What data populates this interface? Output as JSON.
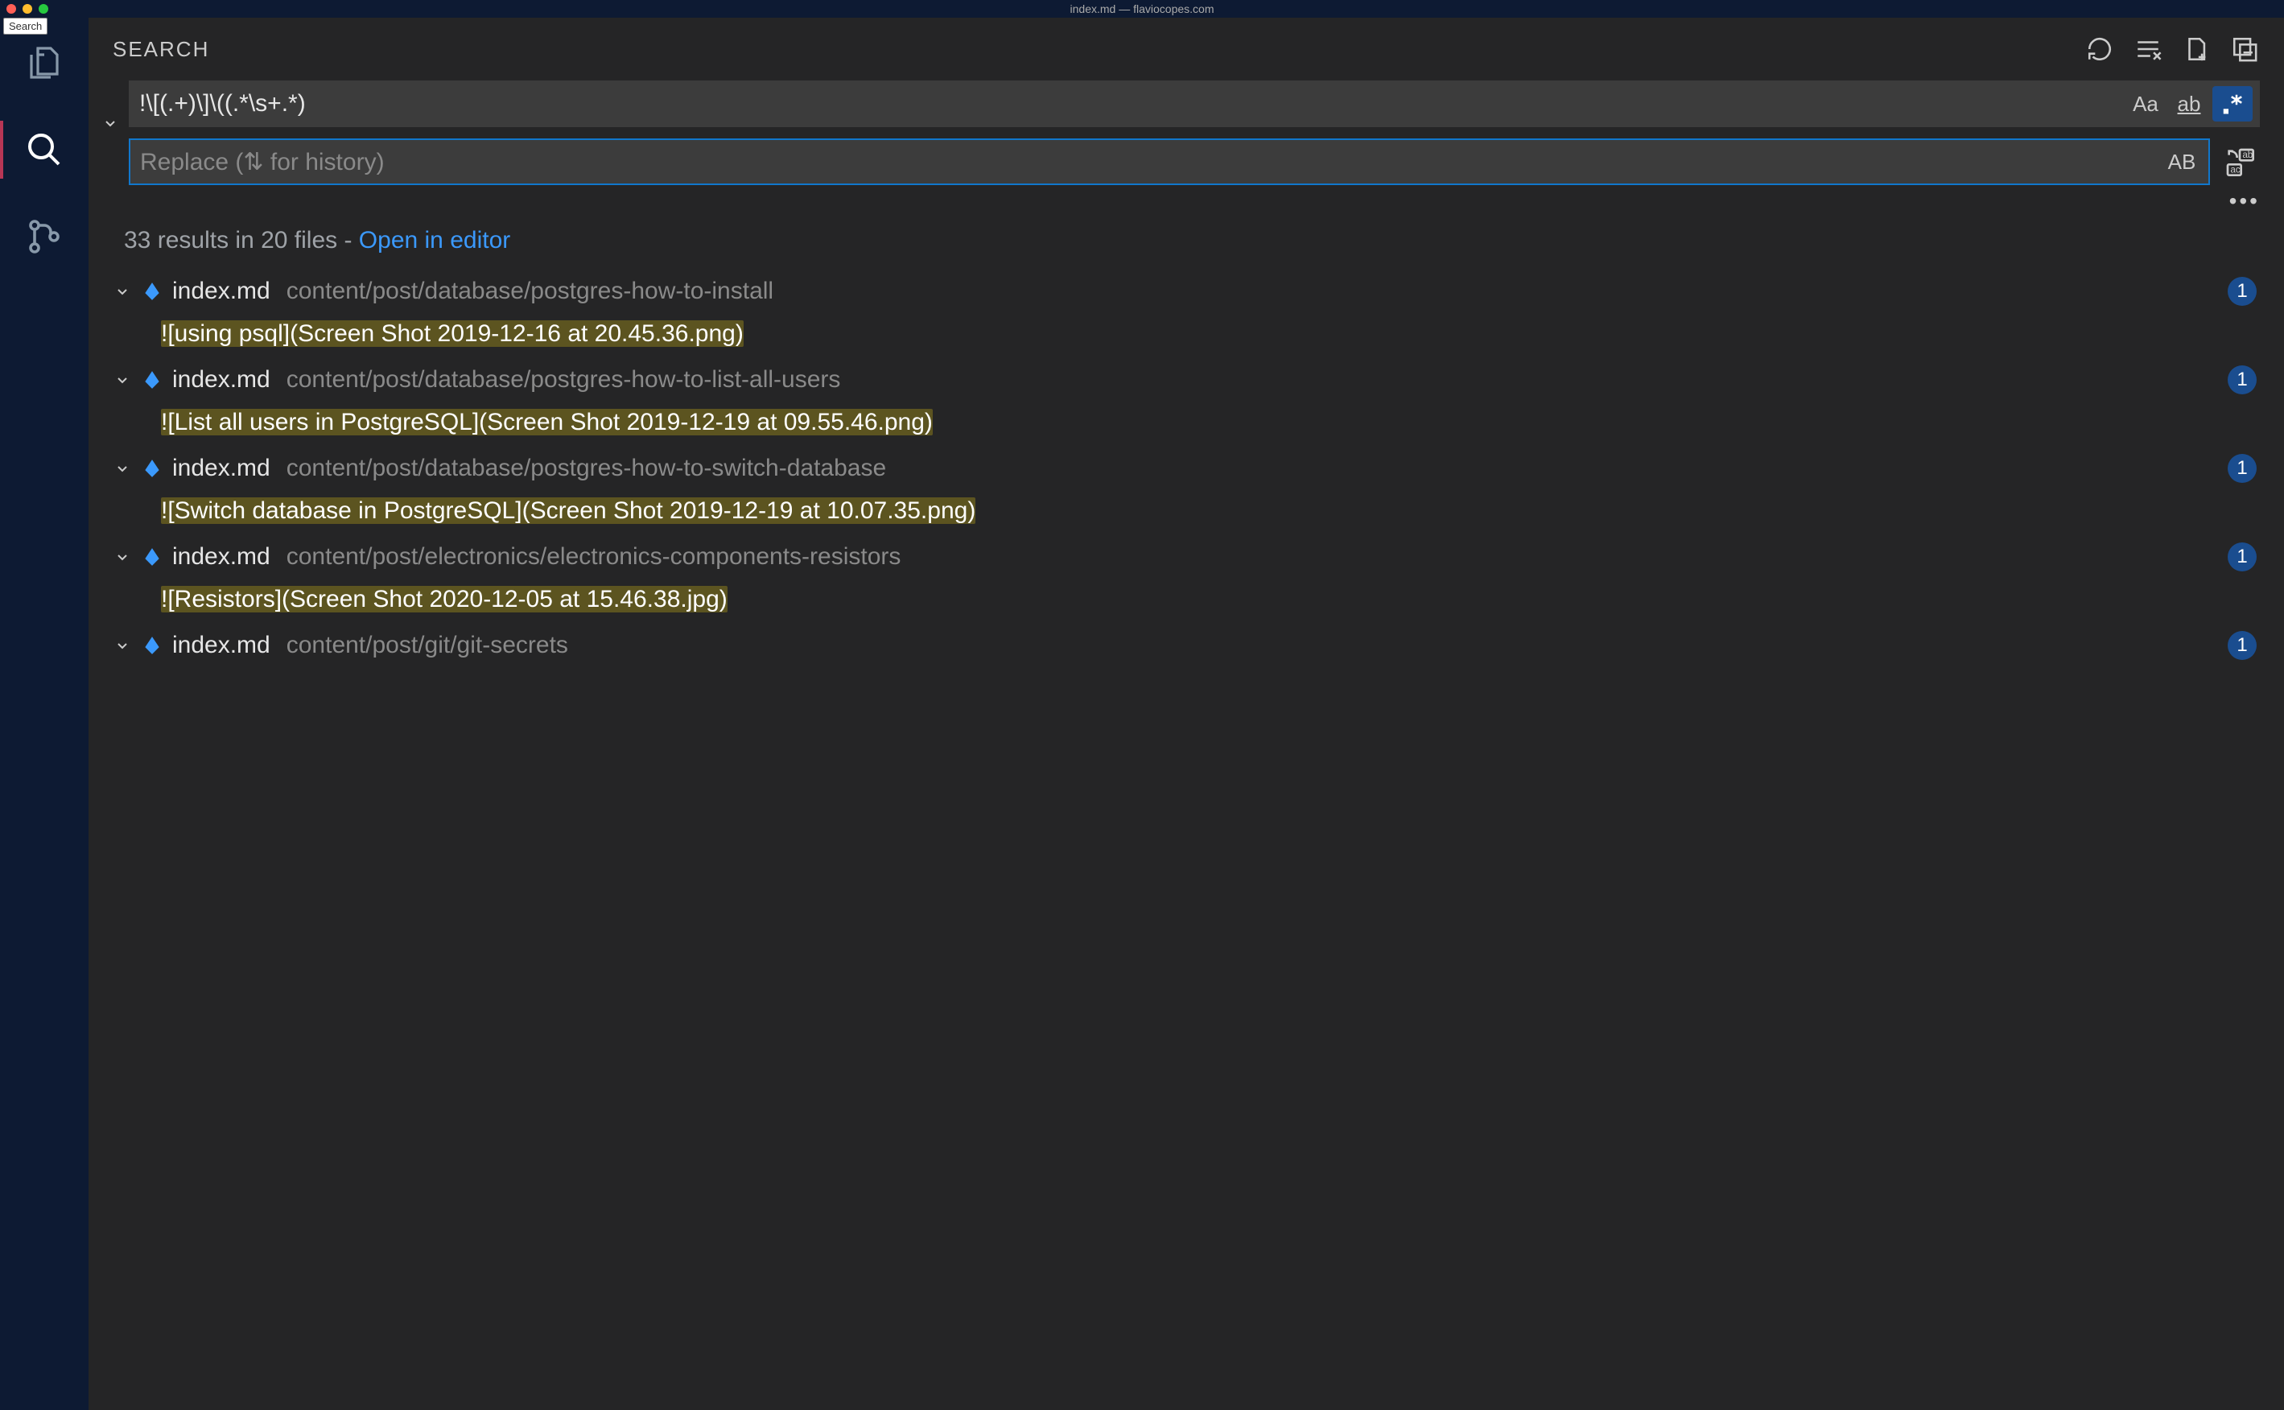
{
  "window": {
    "title": "index.md — flaviocopes.com",
    "tooltip": "Search"
  },
  "activity": {
    "items": [
      "explorer",
      "search",
      "scm"
    ],
    "active": "search"
  },
  "search": {
    "title": "SEARCH",
    "query": "!\\[(.+)\\]\\((.*\\s+.*)",
    "replace_placeholder": "Replace (⇅ for history)",
    "match_case_label": "Aa",
    "whole_word_label": "ab",
    "regex_label": ".*",
    "preserve_case_label": "AB",
    "regex_active": true
  },
  "summary": {
    "text": "33 results in 20 files - ",
    "link": "Open in editor"
  },
  "results": [
    {
      "file": "index.md",
      "path": "content/post/database/postgres-how-to-install",
      "count": "1",
      "match": "![using psql](Screen Shot 2019-12-16 at 20.45.36.png)"
    },
    {
      "file": "index.md",
      "path": "content/post/database/postgres-how-to-list-all-users",
      "count": "1",
      "match": "![List all users in PostgreSQL](Screen Shot 2019-12-19 at 09.55.46.png)"
    },
    {
      "file": "index.md",
      "path": "content/post/database/postgres-how-to-switch-database",
      "count": "1",
      "match": "![Switch database in PostgreSQL](Screen Shot 2019-12-19 at 10.07.35.png)"
    },
    {
      "file": "index.md",
      "path": "content/post/electronics/electronics-components-resistors",
      "count": "1",
      "match": "![Resistors](Screen Shot 2020-12-05 at 15.46.38.jpg)"
    },
    {
      "file": "index.md",
      "path": "content/post/git/git-secrets",
      "count": "1",
      "match": ""
    }
  ]
}
